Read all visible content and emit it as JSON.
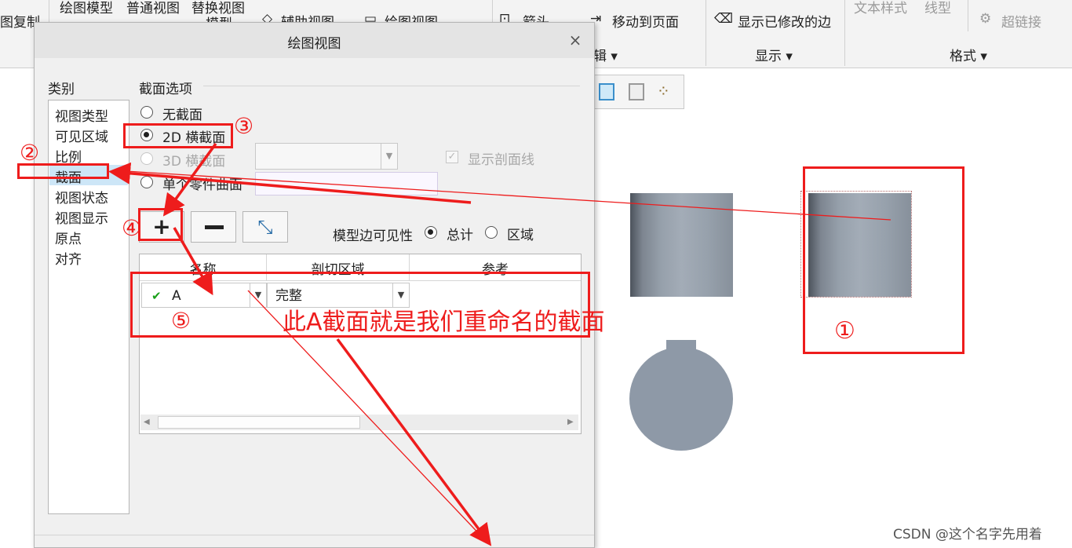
{
  "ribbon": {
    "left_cut_label": "图复制",
    "group1": {
      "row1": [
        "绘图模型",
        "普通视图",
        "替换视图"
      ],
      "row1b": "模型"
    },
    "aux_view": "辅助视图",
    "draw_view": "绘图视图",
    "arrow": "箭头",
    "move_to_page": "移动到页面",
    "edit_menu": "辑",
    "show_modified_edges": "显示已修改的边",
    "display_menu": "显示",
    "text_style": "文本样式",
    "line_style": "线型",
    "hyperlink": "超链接",
    "format_menu": "格式"
  },
  "dialog": {
    "title": "绘图视图",
    "close": "×",
    "category_label": "类别",
    "categories": [
      "视图类型",
      "可见区域",
      "比例",
      "截面",
      "视图状态",
      "视图显示",
      "原点",
      "对齐"
    ],
    "selected_category": "截面",
    "section_options_label": "截面选项",
    "options": {
      "no_section": "无截面",
      "section_2d": "2D 横截面",
      "section_3d": "3D 横截面",
      "single_part_surface": "单个零件曲面"
    },
    "selected_option": "2D 横截面",
    "show_hatch": "显示剖面线",
    "edge_visibility_label": "模型边可见性",
    "edge_total": "总计",
    "edge_region": "区域",
    "edge_selected": "总计",
    "table": {
      "headers": [
        "名称",
        "剖切区域",
        "参考"
      ],
      "rows": [
        {
          "status": "✔",
          "name": "A",
          "region": "完整",
          "ref": ""
        }
      ]
    }
  },
  "annotations": {
    "n1": "①",
    "n2": "②",
    "n3": "③",
    "n4": "④",
    "n5": "⑤",
    "note": "此A截面就是我们重命名的截面"
  },
  "watermark": "CSDN @这个名字先用着",
  "colors": {
    "annotation_red": "#ee1c1c",
    "selection_blue": "#cde6f7",
    "part_gray": "#8e99a7"
  }
}
